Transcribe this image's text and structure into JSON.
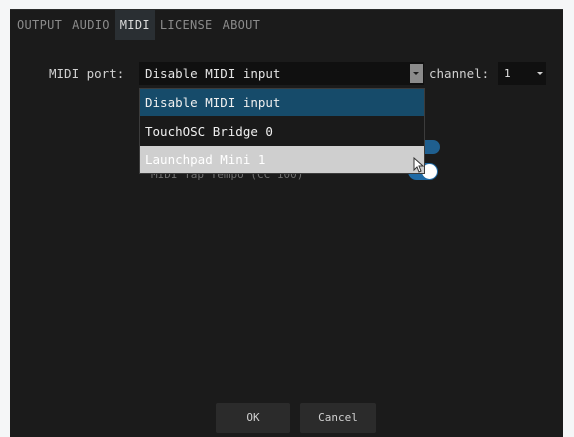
{
  "tabs": [
    "OUTPUT",
    "AUDIO",
    "MIDI",
    "LICENSE",
    "ABOUT"
  ],
  "active_tab": "MIDI",
  "midi": {
    "port_label": "MIDI port:",
    "port_value": "Disable MIDI input",
    "channel_label": "channel:",
    "channel_value": "1",
    "options": [
      "Disable MIDI input",
      "TouchOSC Bridge 0",
      "Launchpad Mini 1"
    ],
    "selected_option": "Disable MIDI input",
    "hovered_option": "Launchpad Mini 1",
    "partially_hidden_setting": "MIDI Tap Tempo (CC 100)"
  },
  "buttons": {
    "ok": "OK",
    "cancel": "Cancel"
  },
  "colors": {
    "window_bg": "#1b1b1b",
    "selected_option_bg": "#164b6a",
    "hover_option_bg": "#cfcfcf",
    "toggle_on": "#1f6aa5"
  },
  "icons": [
    "chevron-down-icon",
    "mouse-cursor-icon"
  ]
}
